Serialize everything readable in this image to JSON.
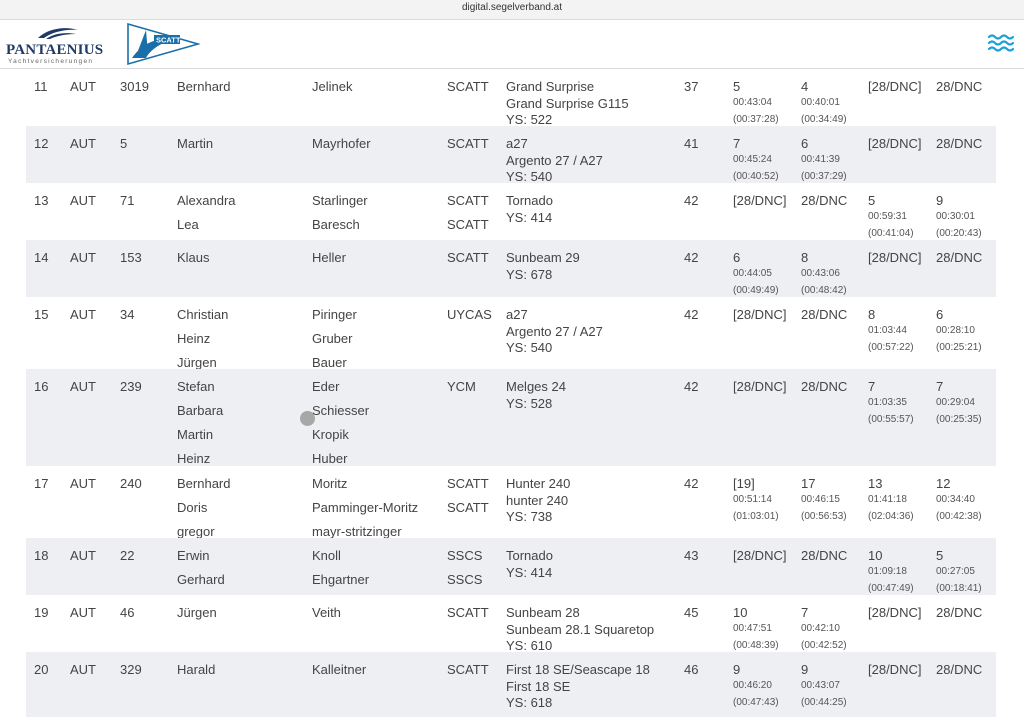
{
  "browser": {
    "url": "digital.segelverband.at"
  },
  "header": {
    "sponsor_logo": {
      "name": "PANTAENIUS",
      "tagline": "Yachtversicherungen"
    },
    "club_logo": {
      "text": "SCATT"
    },
    "menu_icon": "menu-waves-icon",
    "accent_color": "#1aa0d8"
  },
  "rows": [
    {
      "rank": "11",
      "nat": "AUT",
      "sail": "3019",
      "first": [
        "Bernhard"
      ],
      "last": [
        "Jelinek"
      ],
      "club": [
        "SCATT"
      ],
      "boat": [
        "Grand Surprise",
        "Grand Surprise G115",
        "YS: 522"
      ],
      "points": "37",
      "r1": {
        "score": "5",
        "time": "00:43:04",
        "corr": "(00:37:28)"
      },
      "r2": {
        "score": "4",
        "time": "00:40:01",
        "corr": "(00:34:49)"
      },
      "r3": {
        "score": "[28/DNC]",
        "time": "",
        "corr": ""
      },
      "r4": {
        "score": "28/DNC",
        "time": "",
        "corr": ""
      }
    },
    {
      "rank": "12",
      "nat": "AUT",
      "sail": "5",
      "first": [
        "Martin"
      ],
      "last": [
        "Mayrhofer"
      ],
      "club": [
        "SCATT"
      ],
      "boat": [
        "a27",
        "Argento 27 / A27",
        "YS: 540"
      ],
      "points": "41",
      "r1": {
        "score": "7",
        "time": "00:45:24",
        "corr": "(00:40:52)"
      },
      "r2": {
        "score": "6",
        "time": "00:41:39",
        "corr": "(00:37:29)"
      },
      "r3": {
        "score": "[28/DNC]",
        "time": "",
        "corr": ""
      },
      "r4": {
        "score": "28/DNC",
        "time": "",
        "corr": ""
      }
    },
    {
      "rank": "13",
      "nat": "AUT",
      "sail": "71",
      "first": [
        "Alexandra",
        "Lea"
      ],
      "last": [
        "Starlinger",
        "Baresch"
      ],
      "club": [
        "SCATT",
        "SCATT"
      ],
      "boat": [
        "Tornado",
        "YS: 414"
      ],
      "points": "42",
      "r1": {
        "score": "[28/DNC]",
        "time": "",
        "corr": ""
      },
      "r2": {
        "score": "28/DNC",
        "time": "",
        "corr": ""
      },
      "r3": {
        "score": "5",
        "time": "00:59:31",
        "corr": "(00:41:04)"
      },
      "r4": {
        "score": "9",
        "time": "00:30:01",
        "corr": "(00:20:43)"
      }
    },
    {
      "rank": "14",
      "nat": "AUT",
      "sail": "153",
      "first": [
        "Klaus"
      ],
      "last": [
        "Heller"
      ],
      "club": [
        "SCATT"
      ],
      "boat": [
        "Sunbeam 29",
        "YS: 678"
      ],
      "points": "42",
      "r1": {
        "score": "6",
        "time": "00:44:05",
        "corr": "(00:49:49)"
      },
      "r2": {
        "score": "8",
        "time": "00:43:06",
        "corr": "(00:48:42)"
      },
      "r3": {
        "score": "[28/DNC]",
        "time": "",
        "corr": ""
      },
      "r4": {
        "score": "28/DNC",
        "time": "",
        "corr": ""
      }
    },
    {
      "rank": "15",
      "nat": "AUT",
      "sail": "34",
      "first": [
        "Christian",
        "Heinz",
        "Jürgen"
      ],
      "last": [
        "Piringer",
        "Gruber",
        "Bauer"
      ],
      "club": [
        "UYCAS"
      ],
      "boat": [
        "a27",
        "Argento 27 / A27",
        "YS: 540"
      ],
      "points": "42",
      "r1": {
        "score": "[28/DNC]",
        "time": "",
        "corr": ""
      },
      "r2": {
        "score": "28/DNC",
        "time": "",
        "corr": ""
      },
      "r3": {
        "score": "8",
        "time": "01:03:44",
        "corr": "(00:57:22)"
      },
      "r4": {
        "score": "6",
        "time": "00:28:10",
        "corr": "(00:25:21)"
      }
    },
    {
      "rank": "16",
      "nat": "AUT",
      "sail": "239",
      "first": [
        "Stefan",
        "Barbara",
        "Martin",
        "Heinz"
      ],
      "last": [
        "Eder",
        "Schiesser",
        "Kropik",
        "Huber"
      ],
      "club": [
        "YCM"
      ],
      "boat": [
        "Melges 24",
        "YS: 528"
      ],
      "points": "42",
      "r1": {
        "score": "[28/DNC]",
        "time": "",
        "corr": ""
      },
      "r2": {
        "score": "28/DNC",
        "time": "",
        "corr": ""
      },
      "r3": {
        "score": "7",
        "time": "01:03:35",
        "corr": "(00:55:57)"
      },
      "r4": {
        "score": "7",
        "time": "00:29:04",
        "corr": "(00:25:35)"
      }
    },
    {
      "rank": "17",
      "nat": "AUT",
      "sail": "240",
      "first": [
        "Bernhard",
        "Doris",
        "gregor"
      ],
      "last": [
        "Moritz",
        "Pamminger-Moritz",
        "mayr-stritzinger"
      ],
      "club": [
        "SCATT",
        "SCATT"
      ],
      "boat": [
        "Hunter 240",
        "hunter 240",
        "YS: 738"
      ],
      "points": "42",
      "r1": {
        "score": "[19]",
        "time": "00:51:14",
        "corr": "(01:03:01)"
      },
      "r2": {
        "score": "17",
        "time": "00:46:15",
        "corr": "(00:56:53)"
      },
      "r3": {
        "score": "13",
        "time": "01:41:18",
        "corr": "(02:04:36)"
      },
      "r4": {
        "score": "12",
        "time": "00:34:40",
        "corr": "(00:42:38)"
      }
    },
    {
      "rank": "18",
      "nat": "AUT",
      "sail": "22",
      "first": [
        "Erwin",
        "Gerhard"
      ],
      "last": [
        "Knoll",
        "Ehgartner"
      ],
      "club": [
        "SSCS",
        "SSCS"
      ],
      "boat": [
        "Tornado",
        "YS: 414"
      ],
      "points": "43",
      "r1": {
        "score": "[28/DNC]",
        "time": "",
        "corr": ""
      },
      "r2": {
        "score": "28/DNC",
        "time": "",
        "corr": ""
      },
      "r3": {
        "score": "10",
        "time": "01:09:18",
        "corr": "(00:47:49)"
      },
      "r4": {
        "score": "5",
        "time": "00:27:05",
        "corr": "(00:18:41)"
      }
    },
    {
      "rank": "19",
      "nat": "AUT",
      "sail": "46",
      "first": [
        "Jürgen"
      ],
      "last": [
        "Veith"
      ],
      "club": [
        "SCATT"
      ],
      "boat": [
        "Sunbeam 28",
        "Sunbeam 28.1 Squaretop",
        "YS: 610"
      ],
      "points": "45",
      "r1": {
        "score": "10",
        "time": "00:47:51",
        "corr": "(00:48:39)"
      },
      "r2": {
        "score": "7",
        "time": "00:42:10",
        "corr": "(00:42:52)"
      },
      "r3": {
        "score": "[28/DNC]",
        "time": "",
        "corr": ""
      },
      "r4": {
        "score": "28/DNC",
        "time": "",
        "corr": ""
      }
    },
    {
      "rank": "20",
      "nat": "AUT",
      "sail": "329",
      "first": [
        "Harald"
      ],
      "last": [
        "Kalleitner"
      ],
      "club": [
        "SCATT"
      ],
      "boat": [
        "First 18 SE/Seascape 18",
        "First 18 SE",
        "YS: 618"
      ],
      "points": "46",
      "r1": {
        "score": "9",
        "time": "00:46:20",
        "corr": "(00:47:43)"
      },
      "r2": {
        "score": "9",
        "time": "00:43:07",
        "corr": "(00:44:25)"
      },
      "r3": {
        "score": "[28/DNC]",
        "time": "",
        "corr": ""
      },
      "r4": {
        "score": "28/DNC",
        "time": "",
        "corr": ""
      }
    }
  ]
}
